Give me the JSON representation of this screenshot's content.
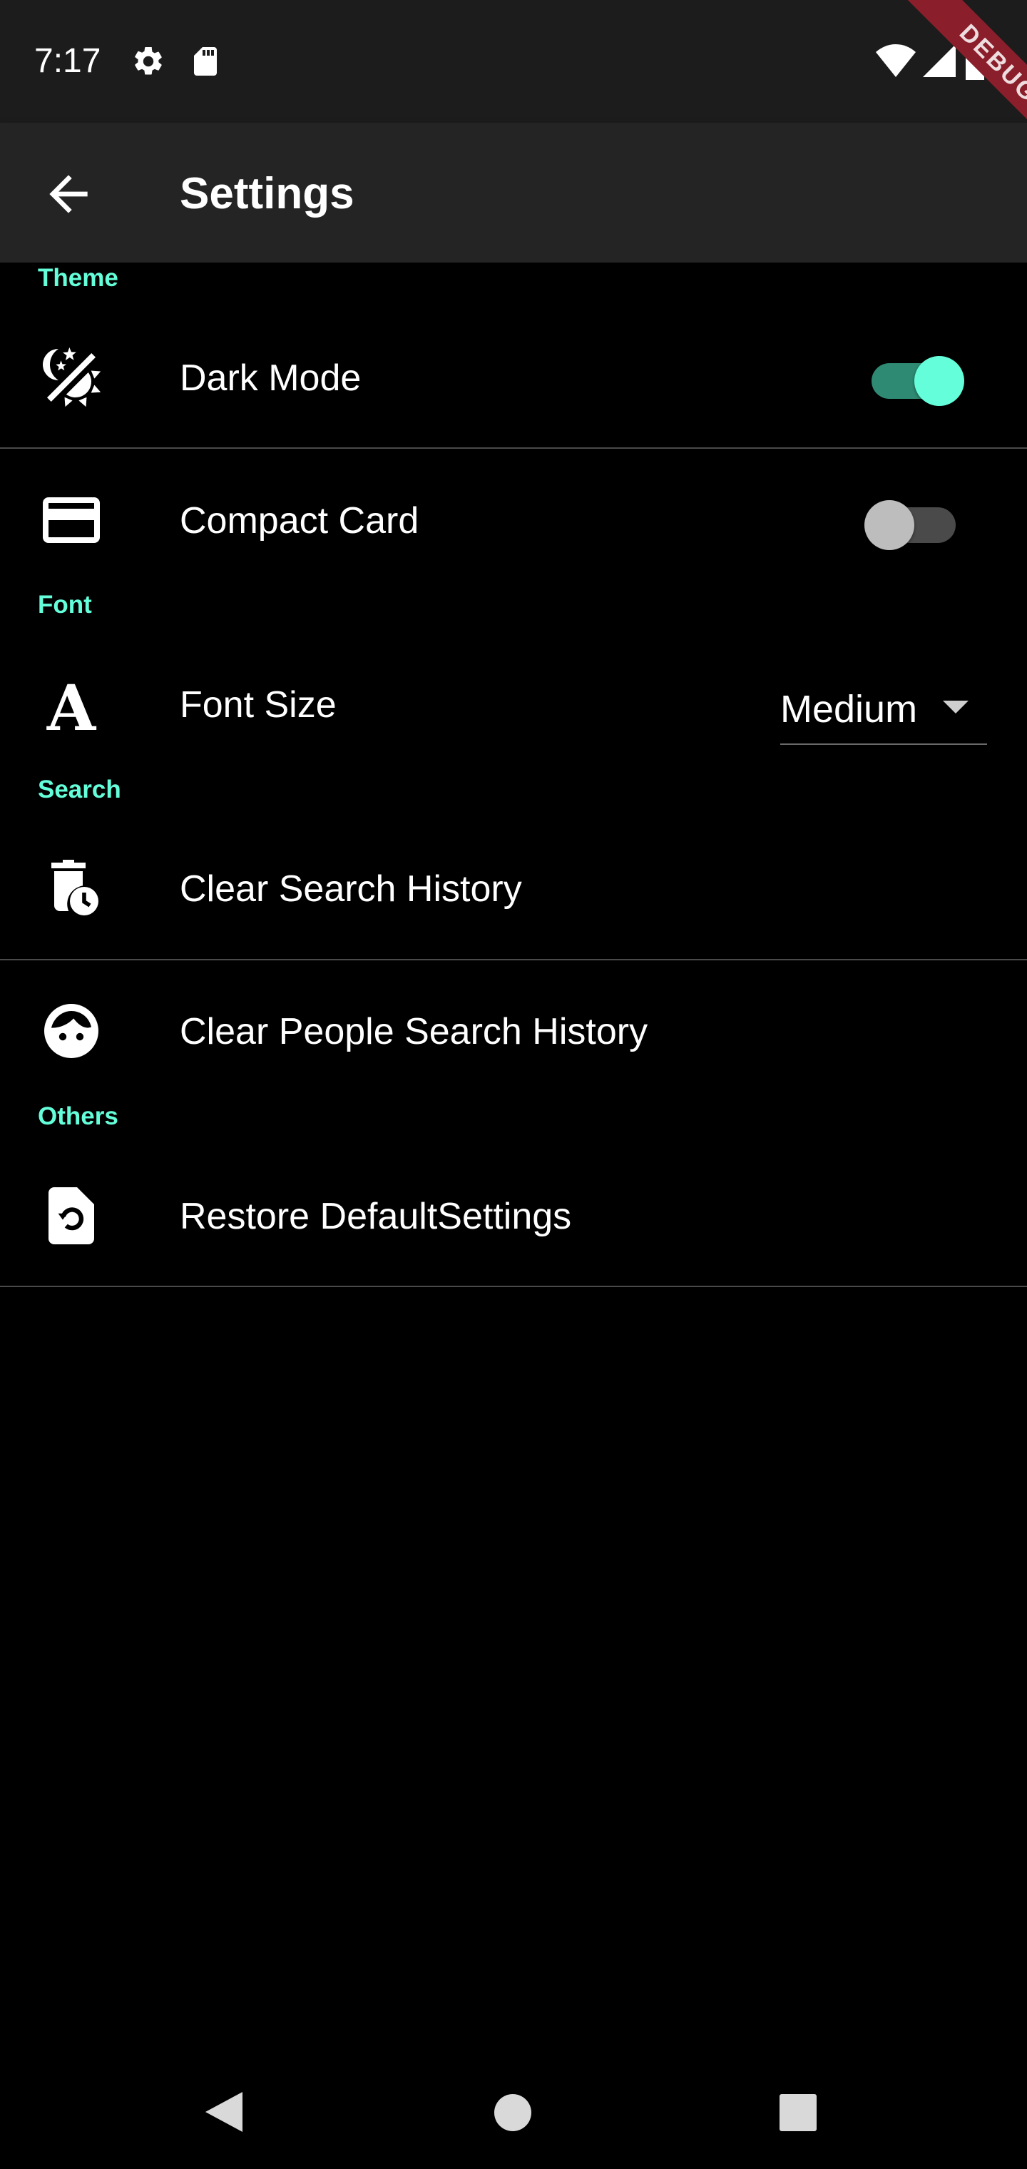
{
  "status_bar": {
    "time": "7:17",
    "left_icons": [
      "gear-icon",
      "sd-card-icon"
    ],
    "right_icons": [
      "wifi-icon",
      "cell-signal-icon",
      "battery-icon"
    ]
  },
  "debug_banner": {
    "label": "DEBUG",
    "color": "#8a1f2b"
  },
  "app_bar": {
    "title": "Settings",
    "back_icon": "arrow-back-icon"
  },
  "colors": {
    "accent": "#64ffda",
    "background": "#000000",
    "app_bar": "#242424",
    "divider": "#4a4a4a"
  },
  "sections": {
    "theme": {
      "header": "Theme",
      "items": {
        "dark_mode": {
          "label": "Dark Mode",
          "icon": "theme-light-dark-icon",
          "enabled": true
        },
        "compact_card": {
          "label": "Compact Card",
          "icon": "credit-card-icon",
          "enabled": false
        }
      }
    },
    "font": {
      "header": "Font",
      "items": {
        "font_size": {
          "label": "Font Size",
          "icon": "format-font-icon",
          "value": "Medium"
        }
      }
    },
    "search": {
      "header": "Search",
      "items": {
        "clear_search_history": {
          "label": "Clear Search History",
          "icon": "delete-clock-icon"
        },
        "clear_people_search_history": {
          "label": "Clear People Search History",
          "icon": "face-icon"
        }
      }
    },
    "others": {
      "header": "Others",
      "items": {
        "restore_defaults": {
          "label": "Restore DefaultSettings",
          "icon": "file-restore-icon"
        }
      }
    }
  },
  "nav_bar": {
    "icons": [
      "nav-back-icon",
      "nav-home-icon",
      "nav-recents-icon"
    ]
  }
}
